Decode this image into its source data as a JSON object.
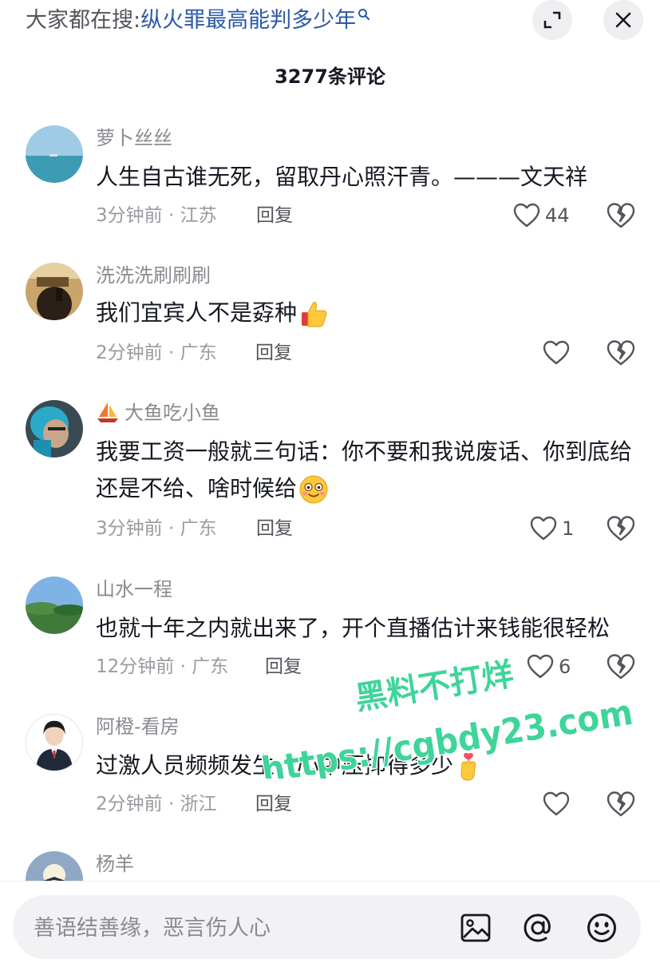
{
  "search_bar": {
    "prefix": "大家都在搜:",
    "query": "纵火罪最高能判多少年"
  },
  "header": {
    "comment_count_label": "3277条评论"
  },
  "comments": [
    {
      "username": "萝卜丝丝",
      "text": "人生自古谁无死，留取丹心照汗青。———文天祥",
      "meta": "3分钟前 · 江苏",
      "reply_label": "回复",
      "likes": "44"
    },
    {
      "username": "洗洗洗刷刷刷",
      "text": "我们宜宾人不是孬种",
      "meta": "2分钟前 · 广东",
      "reply_label": "回复",
      "likes": ""
    },
    {
      "username": "大鱼吃小鱼",
      "text": "我要工资一般就三句话：你不要和我说废话、你到底给还是不给、啥时候给",
      "meta": "3分钟前 · 广东",
      "reply_label": "回复",
      "likes": "1"
    },
    {
      "username": "山水一程",
      "text": "也就十年之内就出来了，开个直播估计来钱能很轻松",
      "meta": "12分钟前 · 广东",
      "reply_label": "回复",
      "likes": "6"
    },
    {
      "username": "阿橙-看房",
      "text": "过激人员频频发生，心中压抑得多少",
      "meta": "2分钟前 · 浙江",
      "reply_label": "回复",
      "likes": ""
    },
    {
      "username": "杨羊"
    }
  ],
  "watermark": {
    "line1": "黑料不打烊",
    "line2": "https://cgbdy23.com"
  },
  "input_bar": {
    "placeholder": "善语结善缘，恶言伤人心"
  },
  "icons": {
    "expand": "expand-icon",
    "close": "close-icon",
    "like": "heart-icon",
    "dislike": "broken-heart-icon",
    "image": "image-icon",
    "mention": "at-icon",
    "emoji": "emoji-icon",
    "search": "search-icon"
  },
  "colors": {
    "search_link": "#2b5aa8",
    "meta_gray": "#9a9ba1",
    "watermark": "#3fd49a"
  }
}
